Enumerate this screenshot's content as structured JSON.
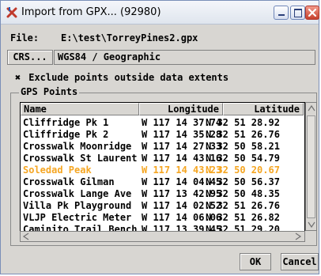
{
  "window": {
    "title": "Import from GPX... (92980)"
  },
  "file": {
    "label": "File:",
    "path": "E:\\test\\TorreyPines2.gpx"
  },
  "crs": {
    "button_label": "CRS...",
    "value": "WGS84 / Geographic"
  },
  "exclude_option": {
    "mark": "✖",
    "label": "Exclude points outside data extents",
    "checked": true
  },
  "gps_points": {
    "group_title": "GPS Points",
    "columns": {
      "name": "Name",
      "longitude": "Longitude",
      "latitude": "Latitude"
    },
    "rows": [
      {
        "name": "Cliffridge Pk 1",
        "longitude": "W 117 14 37.74",
        "latitude": "N 32 51 28.92"
      },
      {
        "name": "Cliffridge Pk 2",
        "longitude": "W 117 14 35.28",
        "latitude": "N 32 51 26.76"
      },
      {
        "name": "Crosswalk Moonridge",
        "longitude": "W 117 14 27.33",
        "latitude": "N 32 50 58.21"
      },
      {
        "name": "Crosswalk St Laurent",
        "longitude": "W 117 14 43.16",
        "latitude": "N 32 50 54.79"
      },
      {
        "name": "Soledad Peak",
        "longitude": "W 117 14 43.23",
        "latitude": "N 32 50 20.67"
      },
      {
        "name": "Crosswalk Gilman",
        "longitude": "W 117 14 04.45",
        "latitude": "N 32 50 56.37"
      },
      {
        "name": "Crosswalk Lange Ave",
        "longitude": "W 117 13 42.95",
        "latitude": "N 32 50 48.35"
      },
      {
        "name": "Villa Pk Playground",
        "longitude": "W 117 14 02.52",
        "latitude": "N 32 51 26.76"
      },
      {
        "name": "VLJP Electric Meter",
        "longitude": "W 117 14 06.06",
        "latitude": "N 32 51 26.82"
      },
      {
        "name": "Caminito Trail Bench",
        "longitude": "W 117 13 39.45",
        "latitude": "N 32 51 29.20"
      }
    ],
    "selected_row": 4
  },
  "buttons": {
    "ok": "OK",
    "cancel": "Cancel"
  },
  "colors": {
    "selected_text": "#f5a623",
    "close_button": "#c6402c",
    "window_bg": "#d8d6d2"
  },
  "icons": {
    "app": "map-pin-icon",
    "minimize": "minimize-icon",
    "maximize": "maximize-icon",
    "close": "close-icon"
  }
}
